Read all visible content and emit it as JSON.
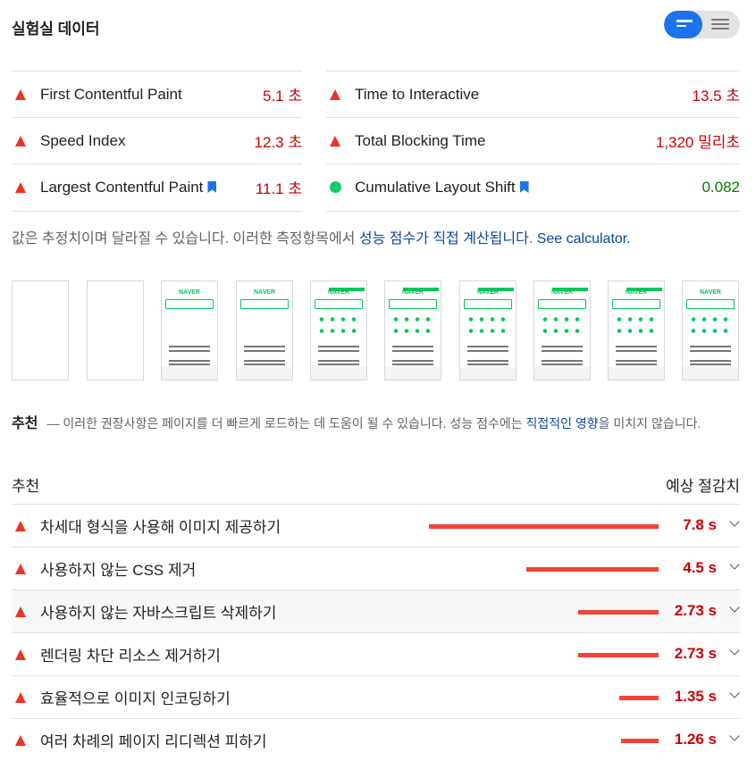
{
  "title": "실험실 데이터",
  "metrics_left": [
    {
      "name": "First Contentful Paint",
      "value": "5.1 초",
      "status": "fail",
      "bookmark": false
    },
    {
      "name": "Speed Index",
      "value": "12.3 초",
      "status": "fail",
      "bookmark": false
    },
    {
      "name": "Largest Contentful Paint",
      "value": "11.1 초",
      "status": "fail",
      "bookmark": true
    }
  ],
  "metrics_right": [
    {
      "name": "Time to Interactive",
      "value": "13.5 초",
      "status": "fail",
      "bookmark": false
    },
    {
      "name": "Total Blocking Time",
      "value": "1,320 밀리초",
      "status": "fail",
      "bookmark": false
    },
    {
      "name": "Cumulative Layout Shift",
      "value": "0.082",
      "status": "pass",
      "bookmark": true
    }
  ],
  "note": {
    "text": "값은 추정치이며 달라질 수 있습니다. 이러한 측정항목에서 ",
    "link": "성능 점수가 직접 계산됩니다",
    "sep": ". ",
    "calc_link": "See calculator."
  },
  "thumb_logo": "NAVER",
  "recommendations": {
    "title": "추천",
    "desc": "— 이러한 권장사항은 페이지를 더 빠르게 로드하는 데 도움이 될 수 있습니다. 성능 점수에는 ",
    "desc_link": "직접적인 영향",
    "desc_tail": "을 미치지 않습니다."
  },
  "columns": {
    "left": "추천",
    "right": "예상 절감치"
  },
  "opportunities": [
    {
      "name": "차세대 형식을 사용해 이미지 제공하기",
      "value": "7.8 s",
      "seconds": 7.8
    },
    {
      "name": "사용하지 않는 CSS 제거",
      "value": "4.5 s",
      "seconds": 4.5
    },
    {
      "name": "사용하지 않는 자바스크립트 삭제하기",
      "value": "2.73 s",
      "seconds": 2.73
    },
    {
      "name": "렌더링 차단 리소스 제거하기",
      "value": "2.73 s",
      "seconds": 2.73
    },
    {
      "name": "효율적으로 이미지 인코딩하기",
      "value": "1.35 s",
      "seconds": 1.35
    },
    {
      "name": "여러 차례의 페이지 리디렉션 피하기",
      "value": "1.26 s",
      "seconds": 1.26
    }
  ],
  "colors": {
    "fail": "#eb3223",
    "pass": "#0cce6b",
    "link": "#0d47a1",
    "toggle": "#1a73e8",
    "bar": "#f44336"
  }
}
